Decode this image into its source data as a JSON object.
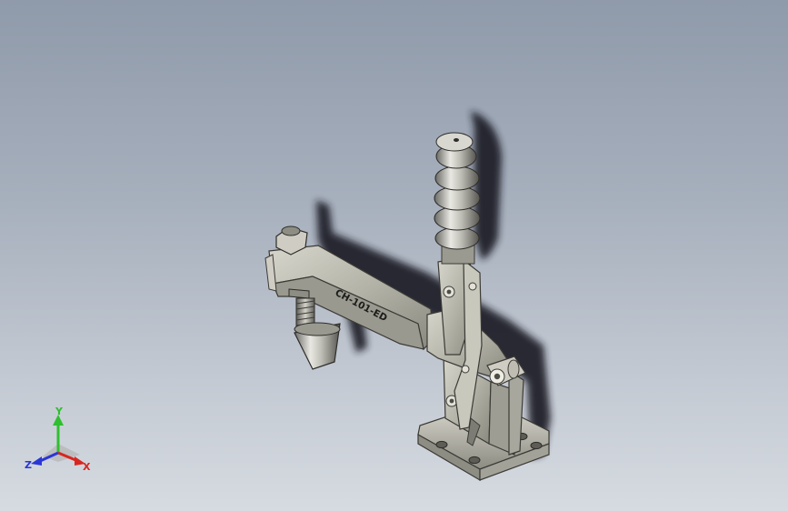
{
  "viewport": {
    "background_top": "#8f9aaa",
    "background_bottom": "#d6dbe1"
  },
  "model": {
    "part_label": "CH-101-ED",
    "metal_color": "#b9b8ad",
    "metal_dark": "#6e6d66",
    "shadow_color": "#1d1f26"
  },
  "triad": {
    "x_label": "X",
    "y_label": "Y",
    "z_label": "Z",
    "x_color": "#d8261f",
    "y_color": "#2fbf2f",
    "z_color": "#2a36d6"
  }
}
